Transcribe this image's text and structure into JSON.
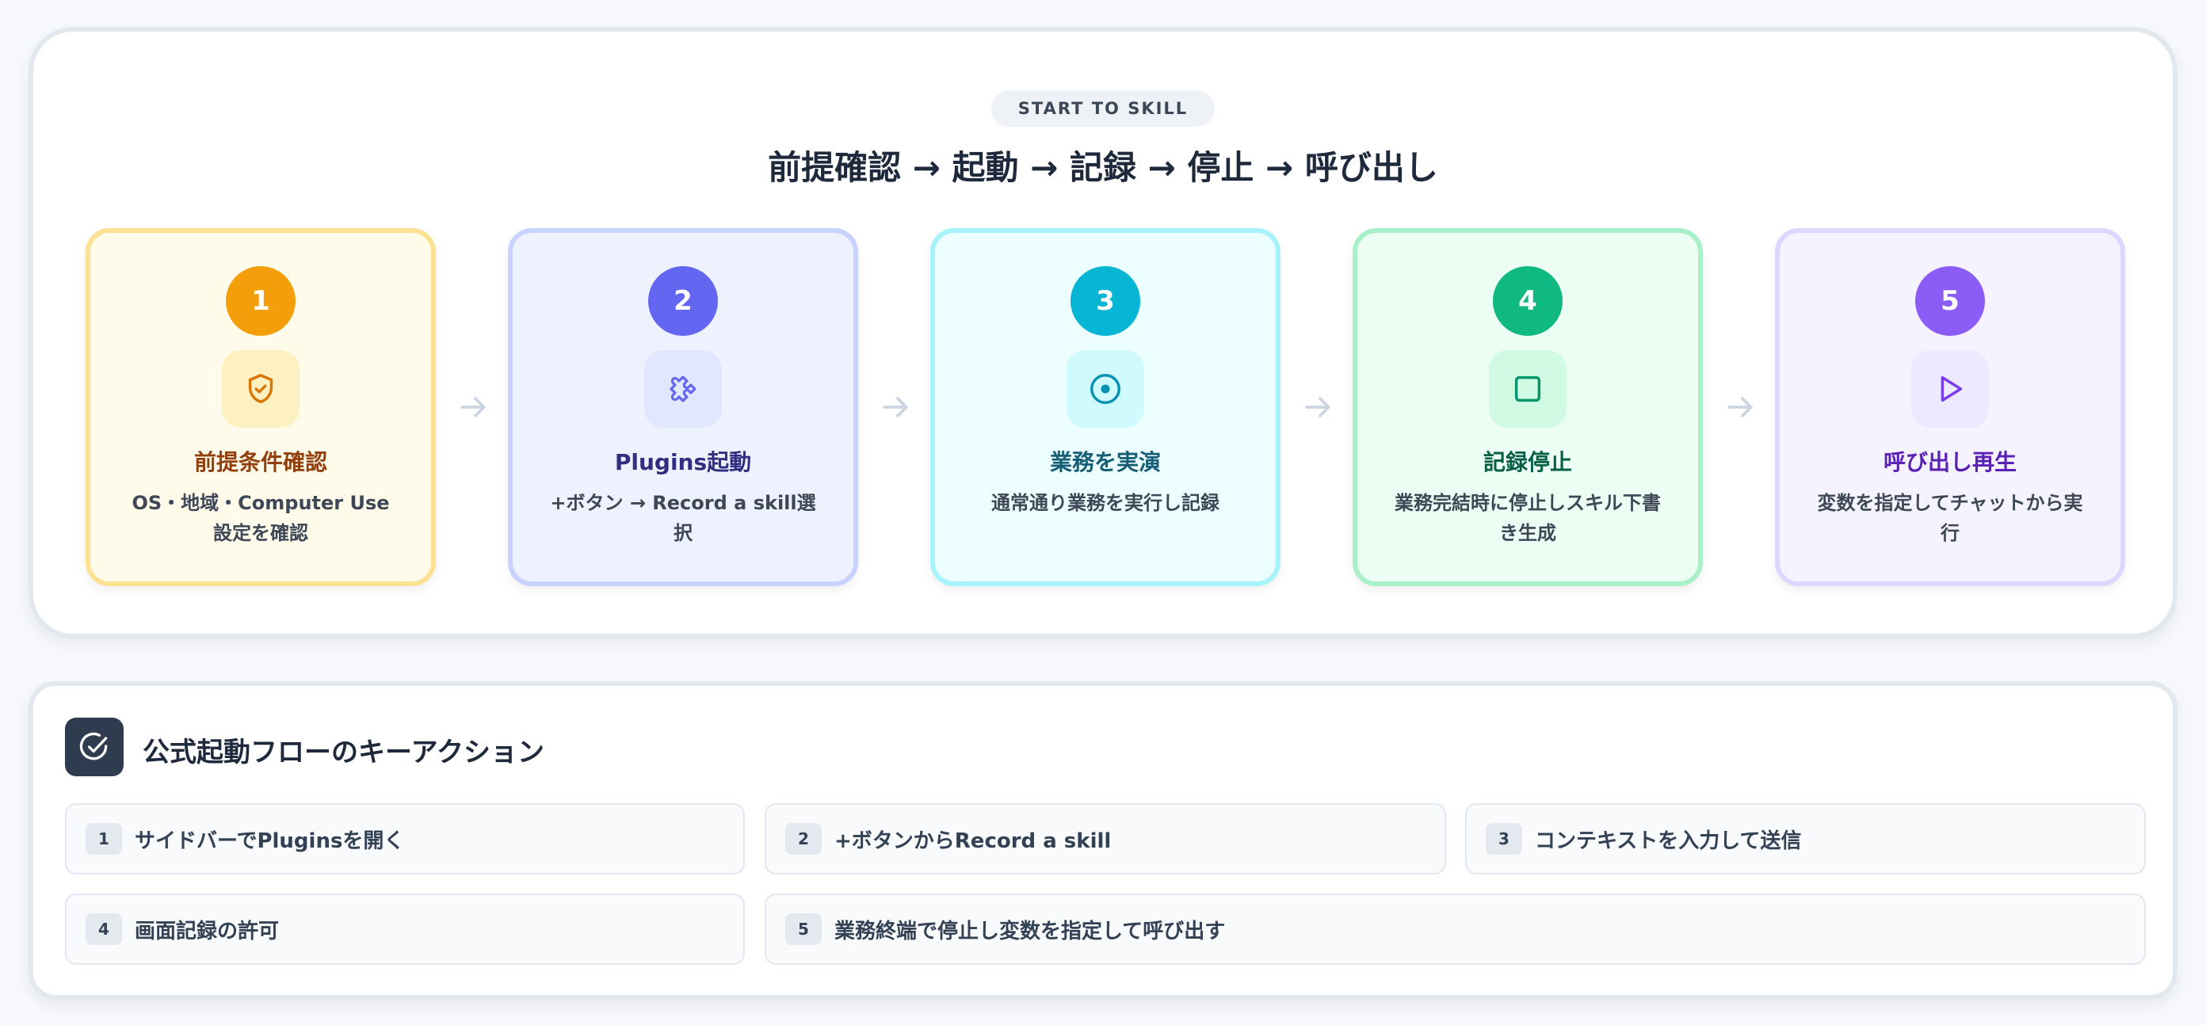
{
  "header": {
    "eyebrow": "START TO SKILL",
    "title": "前提確認 → 起動 → 記録 → 停止 → 呼び出し"
  },
  "steps": [
    {
      "number": "1",
      "icon": "shield-check-icon",
      "title": "前提条件確認",
      "desc": "OS・地域・Computer Use設定を確認",
      "accent": "#f59e0b"
    },
    {
      "number": "2",
      "icon": "puzzle-icon",
      "title": "Plugins起動",
      "desc": "+ボタン → Record a skill選択",
      "accent": "#6366f1"
    },
    {
      "number": "3",
      "icon": "record-icon",
      "title": "業務を実演",
      "desc": "通常通り業務を実行し記録",
      "accent": "#06b6d4"
    },
    {
      "number": "4",
      "icon": "stop-icon",
      "title": "記録停止",
      "desc": "業務完結時に停止しスキル下書き生成",
      "accent": "#10b981"
    },
    {
      "number": "5",
      "icon": "play-icon",
      "title": "呼び出し再生",
      "desc": "変数を指定してチャットから実行",
      "accent": "#8b5cf6"
    }
  ],
  "key_actions": {
    "icon": "check-circle-icon",
    "title": "公式起動フローのキーアクション",
    "items": [
      {
        "index": "1",
        "text": "サイドバーでPluginsを開く"
      },
      {
        "index": "2",
        "text": "+ボタンからRecord a skill"
      },
      {
        "index": "3",
        "text": "コンテキストを入力して送信"
      },
      {
        "index": "4",
        "text": "画面記録の許可"
      },
      {
        "index": "5",
        "text": "業務終端で停止し変数を指定して呼び出す"
      }
    ]
  }
}
